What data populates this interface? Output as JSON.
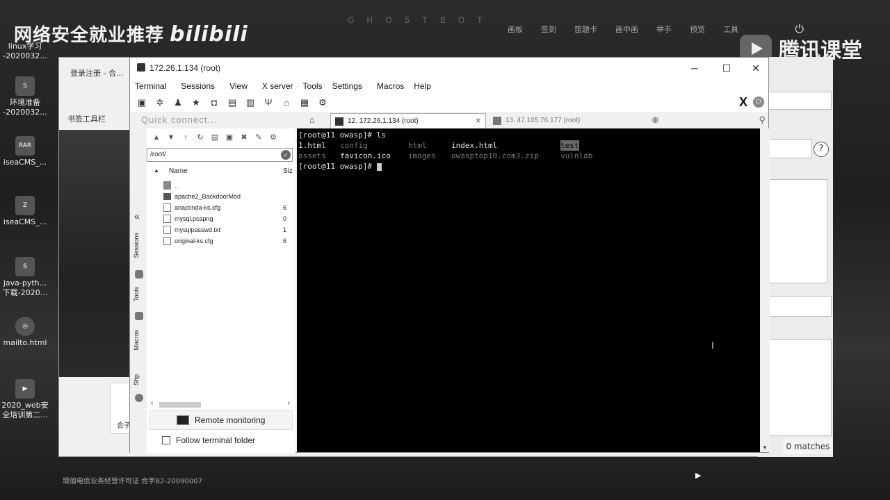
{
  "overlay": {
    "watermark": "网络安全就业推荐",
    "watermark_brand": "bilibili",
    "ghost_menu": "GHOSTBOT",
    "top_menu": [
      "画板",
      "签到",
      "笛题卡",
      "画中画",
      "举手",
      "预览",
      "工具"
    ],
    "tencent": "腾讯课堂",
    "footer": "增值电信业务经营许可证 合字B2-20090007"
  },
  "desktop_icons": [
    {
      "label": "linux学习\n-2020032...",
      "icon": "txt-icon"
    },
    {
      "label": "环境准备\n-2020032...",
      "icon": "app-icon"
    },
    {
      "label": "iseaCMS_...",
      "icon": "rar-icon",
      "badge": "RAR"
    },
    {
      "label": "iseaCMS_...",
      "icon": "zip-icon"
    },
    {
      "label": "java-pyth...\n下载-2020...",
      "icon": "app-icon"
    },
    {
      "label": "mailto.html",
      "icon": "browser-icon"
    },
    {
      "label": "2020_web安\n全培训第二...",
      "icon": "video-icon"
    }
  ],
  "browser": {
    "title": "登录注册 - 合...",
    "bookmark": "书签工具栏",
    "card_text": "合子",
    "find_matches": "0 matches"
  },
  "moba": {
    "title": "172.26.1.134 (root)",
    "menu": [
      "Terminal",
      "Sessions",
      "View",
      "X server",
      "Tools",
      "Settings",
      "Macros",
      "Help"
    ],
    "quick_connect_placeholder": "Quick connect...",
    "tabs": [
      {
        "label": "12. 172.26.1.134 (root)",
        "active": true
      },
      {
        "label": "13. 47.105.76.177 (root)",
        "active": false
      }
    ],
    "side_tabs": [
      "Sessions",
      "Tools",
      "Macros",
      "Sftp"
    ],
    "sftp": {
      "path": "/root/",
      "col_name": "Name",
      "col_size": "Siz",
      "files": [
        {
          "name": "..",
          "size": "",
          "type": "parent"
        },
        {
          "name": "apache2_BackdoorMod",
          "size": "",
          "type": "folder"
        },
        {
          "name": "anaconda-ks.cfg",
          "size": "6",
          "type": "file"
        },
        {
          "name": "mysql.pcapng",
          "size": "0",
          "type": "file"
        },
        {
          "name": "mysqlpasswd.txt",
          "size": "1",
          "type": "file"
        },
        {
          "name": "original-ks.cfg",
          "size": "6",
          "type": "file"
        }
      ],
      "remote_monitoring": "Remote monitoring",
      "follow_folder": "Follow terminal folder"
    },
    "terminal": {
      "prompt1": "[root@11 owasp]# ",
      "cmd1": "ls",
      "row1": [
        "1.html",
        "config",
        "html",
        "index.html",
        "test"
      ],
      "row2": [
        "assets",
        "favicon.ico",
        "images",
        "owasptop10.com3.zip",
        "vulnlab"
      ],
      "prompt2": "[root@11 owasp]# "
    },
    "colors": {
      "dir": "#7a7a7a",
      "file": "#e6e6e6",
      "highlight_bg": "#6a6a6a"
    }
  }
}
